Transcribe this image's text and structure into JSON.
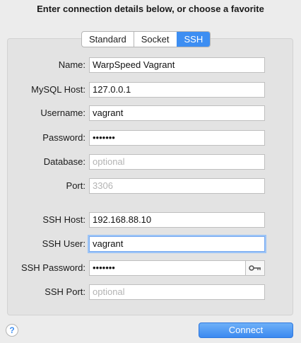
{
  "header": {
    "title": "Enter connection details below, or choose a favorite"
  },
  "tabs": [
    {
      "label": "Standard",
      "active": false
    },
    {
      "label": "Socket",
      "active": false
    },
    {
      "label": "SSH",
      "active": true
    }
  ],
  "form": {
    "name": {
      "label": "Name:",
      "value": "WarpSpeed Vagrant"
    },
    "mysql_host": {
      "label": "MySQL Host:",
      "value": "127.0.0.1"
    },
    "username": {
      "label": "Username:",
      "value": "vagrant"
    },
    "password": {
      "label": "Password:",
      "value": "•••••••"
    },
    "database": {
      "label": "Database:",
      "placeholder": "optional"
    },
    "port": {
      "label": "Port:",
      "placeholder": "3306"
    },
    "ssh_host": {
      "label": "SSH Host:",
      "value": "192.168.88.10"
    },
    "ssh_user": {
      "label": "SSH User:",
      "value": "vagrant"
    },
    "ssh_password": {
      "label": "SSH Password:",
      "value": "•••••••"
    },
    "ssh_port": {
      "label": "SSH Port:",
      "placeholder": "optional"
    }
  },
  "footer": {
    "help": "?",
    "connect_label": "Connect"
  },
  "colors": {
    "accent": "#3d8ef2",
    "focus_ring": "#9cc4f6"
  },
  "icons": {
    "ssh_key": "key-icon",
    "help": "help-icon"
  }
}
